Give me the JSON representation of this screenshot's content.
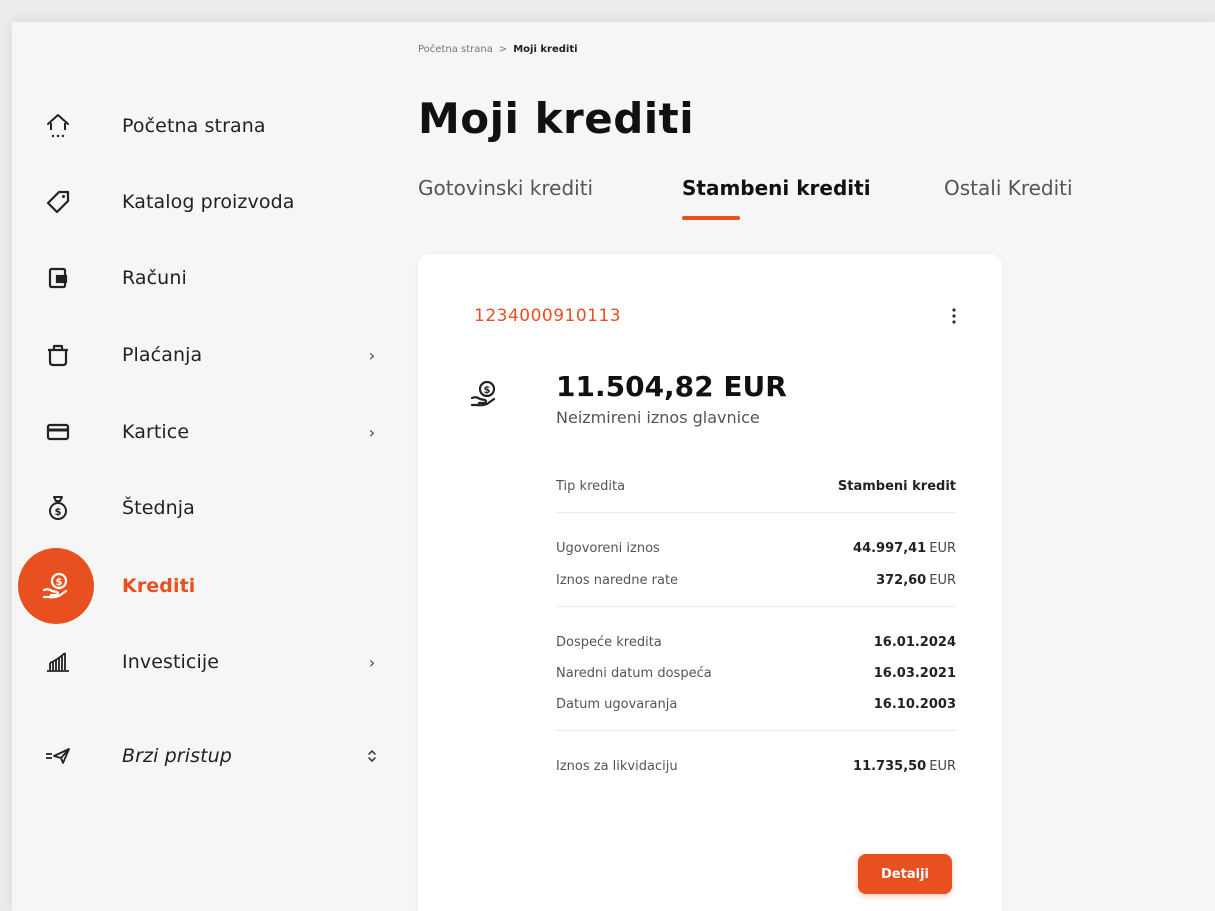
{
  "breadcrumb": {
    "home": "Početna strana",
    "separator": ">",
    "current": "Moji krediti"
  },
  "page": {
    "title": "Moji krediti"
  },
  "sidebar": {
    "items": [
      {
        "label": "Početna strana",
        "icon": "home-icon"
      },
      {
        "label": "Katalog proizvoda",
        "icon": "tag-icon"
      },
      {
        "label": "Računi",
        "icon": "wallet-icon"
      },
      {
        "label": "Plaćanja",
        "icon": "pot-icon",
        "chevron": "›"
      },
      {
        "label": "Kartice",
        "icon": "card-icon",
        "chevron": "›"
      },
      {
        "label": "Štednja",
        "icon": "money-bag-icon"
      },
      {
        "label": "Krediti",
        "icon": "loan-hand-icon",
        "active": true
      },
      {
        "label": "Investicije",
        "icon": "chart-icon",
        "chevron": "›"
      },
      {
        "label": "Brzi pristup",
        "icon": "quick-access-icon",
        "chevron": "⌃⌄"
      }
    ]
  },
  "tabs": [
    {
      "label": "Gotovinski krediti"
    },
    {
      "label": "Stambeni krediti",
      "active": true
    },
    {
      "label": "Ostali Krediti"
    }
  ],
  "loan": {
    "account_number": "1234000910113",
    "amount": "11.504,82 EUR",
    "amount_label": "Neizmireni iznos glavnice",
    "rows": {
      "tip_kredita": {
        "label": "Tip kredita",
        "value": "Stambeni kredit"
      },
      "ugovoreni_iznos": {
        "label": "Ugovoreni iznos",
        "value": "44.997,41",
        "unit": "EUR"
      },
      "iznos_rate": {
        "label": "Iznos naredne rate",
        "value": "372,60",
        "unit": "EUR"
      },
      "dospece": {
        "label": "Dospeće kredita",
        "value": "16.01.2024"
      },
      "naredni_datum": {
        "label": "Naredni datum dospeća",
        "value": "16.03.2021"
      },
      "datum_ugovaranja": {
        "label": "Datum ugovaranja",
        "value": "16.10.2003"
      },
      "likvidacija": {
        "label": "Iznos za likvidaciju",
        "value": "11.735,50",
        "unit": "EUR"
      }
    },
    "button": "Detalji"
  },
  "colors": {
    "accent": "#e8501f",
    "background": "#f6f6f6",
    "card": "#ffffff"
  }
}
